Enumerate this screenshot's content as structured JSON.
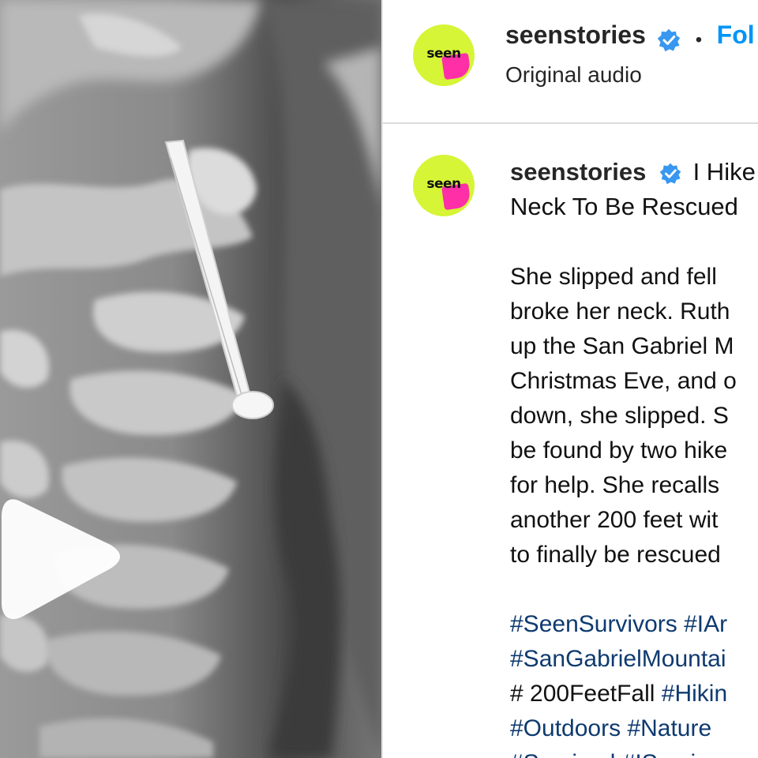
{
  "post_media": {
    "type": "video",
    "description_icon": "play-icon"
  },
  "header": {
    "username": "seenstories",
    "verified": true,
    "separator": "•",
    "follow_label": "Fol",
    "audio_label": "Original audio",
    "avatar_text": "seen"
  },
  "caption": {
    "username": "seenstories",
    "avatar_text": "seen",
    "title_line1": "I Hike",
    "title_line2": "Neck To Be Rescued",
    "body_lines": [
      "She slipped and fell",
      "broke her neck. Ruth",
      "up the San Gabriel M",
      "Christmas Eve, and o",
      "down, she slipped. S",
      "be found by two hike",
      "for help. She recalls",
      "another 200 feet wit",
      "to finally be rescued"
    ],
    "hashtag_lines": [
      [
        {
          "text": "#SeenSurvivors",
          "link": true
        },
        {
          "text": " ",
          "link": false
        },
        {
          "text": "#IAr",
          "link": true
        }
      ],
      [
        {
          "text": "#SanGabrielMountai",
          "link": true
        }
      ],
      [
        {
          "text": "# 200FeetFall ",
          "link": false
        },
        {
          "text": "#Hikin",
          "link": true
        }
      ],
      [
        {
          "text": "#Outdoors",
          "link": true
        },
        {
          "text": " ",
          "link": false
        },
        {
          "text": "#Nature",
          "link": true
        }
      ],
      [
        {
          "text": "#Survived",
          "link": true
        },
        {
          "text": " ",
          "link": false
        },
        {
          "text": "#ISurvive",
          "link": true
        }
      ]
    ]
  },
  "colors": {
    "accent_blue": "#0095f6",
    "hashtag_blue": "#0e3a6f",
    "avatar_lime": "#d6f536",
    "avatar_pink": "#ff2fa8",
    "verified_blue": "#3897f0"
  }
}
